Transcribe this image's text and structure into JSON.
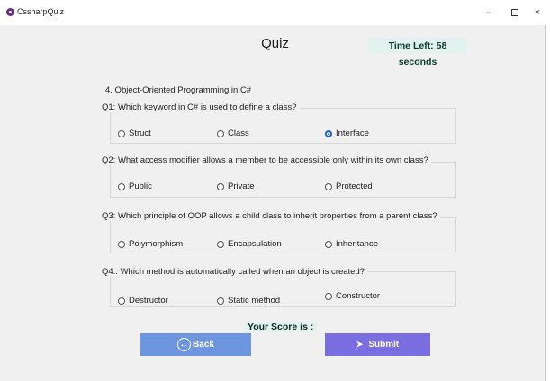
{
  "window": {
    "title": "CssharpQuiz",
    "controls": {
      "minimize": "–",
      "maximize": "",
      "close": "×"
    }
  },
  "header": {
    "title": "Quiz",
    "timer": "Time Left: 58 seconds"
  },
  "section": {
    "title": "4. Object-Oriented Programming in C#"
  },
  "questions": [
    {
      "text": "Q1: Which keyword in C# is used to define a class?",
      "options": [
        "Struct",
        "Class",
        "Interface"
      ],
      "selected": 2
    },
    {
      "text": "Q2: What access modifier allows a member to be accessible only within its own class?",
      "options": [
        "Public",
        "Private",
        "Protected"
      ],
      "selected": null
    },
    {
      "text": "Q3: Which principle of OOP allows a child class to inherit properties from a parent class?",
      "options": [
        "Polymorphism",
        "Encapsulation",
        "Inheritance"
      ],
      "selected": null
    },
    {
      "text": "Q4:: Which method is automatically called when an object is created?",
      "options": [
        "Destructor",
        "Static method",
        "Constructor"
      ],
      "selected": null
    }
  ],
  "footer": {
    "score_label": "Your Score  is :",
    "back_label": "Back",
    "submit_label": "Submit",
    "back_icon": "arrow-left-circle-icon",
    "submit_icon": "chevron-right-icon"
  },
  "colors": {
    "back_button": "#6d95e0",
    "submit_button": "#7a6ee0",
    "timer_bg": "#e3f1ef",
    "radio_checked": "#1a5fd0"
  }
}
